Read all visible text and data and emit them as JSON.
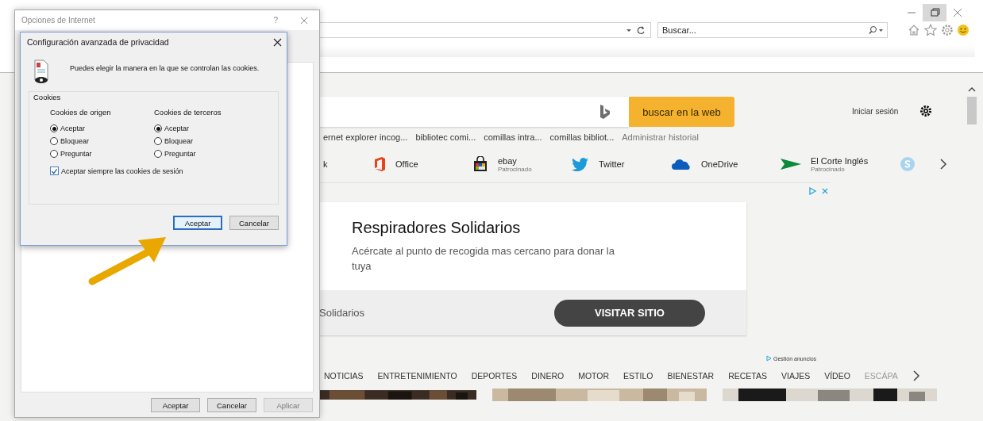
{
  "browser": {
    "search_field": {
      "placeholder": "Buscar..."
    }
  },
  "page": {
    "search_button": "buscar en la web",
    "sign_in": "Iniciar sesión",
    "history": [
      "ernet explorer incog...",
      "bibliotec comi...",
      "comillas intra...",
      "comillas bibliot...",
      "Administrar historial"
    ],
    "quick_links": [
      {
        "label": "k"
      },
      {
        "label": "Office"
      },
      {
        "label": "ebay",
        "note": "Patrocinado"
      },
      {
        "label": "Twitter"
      },
      {
        "label": "OneDrive"
      },
      {
        "label": "El Corte Inglés",
        "note": "Patrocinado"
      }
    ],
    "ad": {
      "title": "Respiradores Solidarios",
      "text": "Acércate al punto de recogida mas cercano para donar la tuya",
      "footer": "Solidarios",
      "button": "VISITAR SITIO"
    },
    "ad_management": "Gestión anuncios",
    "categories": [
      {
        "label": "NOTICIAS",
        "faded": false
      },
      {
        "label": "ENTRETENIMIENTO",
        "faded": false
      },
      {
        "label": "DEPORTES",
        "faded": false
      },
      {
        "label": "DINERO",
        "faded": false
      },
      {
        "label": "MOTOR",
        "faded": false
      },
      {
        "label": "ESTILO",
        "faded": false
      },
      {
        "label": "BIENESTAR",
        "faded": false
      },
      {
        "label": "RECETAS",
        "faded": false
      },
      {
        "label": "VIAJES",
        "faded": false
      },
      {
        "label": "VÍDEO",
        "faded": false
      },
      {
        "label": "ESCÁPA",
        "faded": true
      }
    ]
  },
  "options_dialog": {
    "title": "Opciones de Internet",
    "help": "?",
    "buttons": [
      {
        "label": "Aceptar",
        "disabled": false
      },
      {
        "label": "Cancelar",
        "disabled": false
      },
      {
        "label": "Aplicar",
        "disabled": true
      }
    ]
  },
  "privacy_dialog": {
    "title": "Configuración avanzada de privacidad",
    "intro": "Puedes elegir la manera en la que se controlan las cookies.",
    "group": "Cookies",
    "columns": [
      {
        "heading": "Cookies de origen",
        "options": [
          {
            "label": "Aceptar",
            "selected": true
          },
          {
            "label": "Bloquear",
            "selected": false
          },
          {
            "label": "Preguntar",
            "selected": false
          }
        ]
      },
      {
        "heading": "Cookies de terceros",
        "options": [
          {
            "label": "Aceptar",
            "selected": true
          },
          {
            "label": "Bloquear",
            "selected": false
          },
          {
            "label": "Preguntar",
            "selected": false
          }
        ]
      }
    ],
    "session_cookies": {
      "label": "Aceptar siempre las cookies de sesión",
      "checked": true
    },
    "buttons": [
      {
        "label": "Aceptar",
        "focused": true
      },
      {
        "label": "Cancelar",
        "focused": false
      }
    ]
  }
}
